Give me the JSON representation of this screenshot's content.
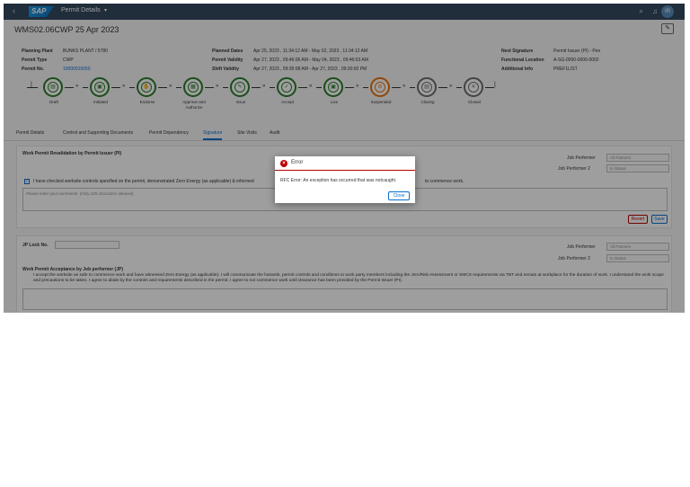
{
  "shell": {
    "back_icon": "‹",
    "logo_text": "SAP",
    "title": "Permit Details",
    "chevron": "▾",
    "search_icon": "⌕",
    "notification_icon": "♫",
    "avatar_initials": "IR"
  },
  "header": {
    "object_title": "WMS02.06CWP 25 Apr 2023",
    "edit_icon": "✎",
    "left": [
      {
        "label": "Planning Plant",
        "value": "BUNKS PLANT / 5780"
      },
      {
        "label": "Permit Type",
        "value": "CWP"
      },
      {
        "label": "Permit No.",
        "value": "10000010050"
      }
    ],
    "middle": [
      {
        "label": "Planned Dates",
        "value": "Apr 25, 2023 , 11:34:12 AM - May 02, 2023 , 11:34:12 AM"
      },
      {
        "label": "Permit Validity",
        "value": "Apr 27, 2023 , 09:46:06 AM - May 04, 2023 , 09:46:03 AM"
      },
      {
        "label": "Shift Validity",
        "value": "Apr 27, 2023 , 09:35:08 AM - Apr 27, 2023 , 09:30:00 PM"
      }
    ],
    "right": [
      {
        "label": "Next Signature",
        "value": "Permit Issuer (PI) - Pen"
      },
      {
        "label": "Functional Location",
        "value": "A-SG-0000-0000-0002"
      },
      {
        "label": "Additional Info",
        "value": "PREF1LIST"
      }
    ]
  },
  "steps": [
    {
      "label": "Draft",
      "icon": "▤",
      "state": "done"
    },
    {
      "label": "Initiated",
      "icon": "▣",
      "state": "done"
    },
    {
      "label": "Endorse",
      "icon": "✋",
      "state": "done"
    },
    {
      "label": "Approve and Authorize",
      "icon": "▦",
      "state": "done"
    },
    {
      "label": "Issue",
      "icon": "✎",
      "state": "done"
    },
    {
      "label": "Accept",
      "icon": "✓",
      "state": "done"
    },
    {
      "label": "Live",
      "icon": "▣",
      "state": "done"
    },
    {
      "label": "Suspended",
      "icon": "⊘",
      "state": "current"
    },
    {
      "label": "Closing",
      "icon": "▤",
      "state": "pending"
    },
    {
      "label": "Closed",
      "icon": "✕",
      "state": "pending"
    }
  ],
  "tabs": [
    "Permit Details",
    "Control and Supporting Documents",
    "Permit Dependency",
    "Signature",
    "Site Visits",
    "Audit"
  ],
  "active_tab": "Signature",
  "revalidation": {
    "title": "Work Permit Revalidation by Permit Issuer (PI)",
    "job_performer_label": "Job Performer",
    "job_performer_placeholder": "All Partners",
    "job_performer2_label": "Job Performer 2",
    "job_performer2_placeholder": "In Status",
    "checkbox_text": "I have checked worksite controls specified on the permit, demonstrated Zero Energy (as applicable) & informed",
    "checkbox_text_tail": "to commence work.",
    "comment_placeholder": "Please enter your comments. (Only 225 characters allowed)",
    "reject_label": "Revert",
    "save_label": "Save"
  },
  "acceptance": {
    "jp_lock_label": "JP Lock No.",
    "job_performer_label": "Job Performer",
    "job_performer_placeholder": "All Partners",
    "job_performer2_label": "Job Performer 2",
    "job_performer2_placeholder": "In Status",
    "title": "Work Permit Acceptance by Job performer (JP)",
    "text": "I accept the worksite as safe to commence work and have witnessed Zero Energy (as applicable). I will communicate the hazards, permit controls and conditions to work party members including the JSA/Risk Assessment or SMCS requirements via TBT and remain at workplace for the duration of work. I understand the work scope and precautions to be taken. I agree to abide by the controls and requirements described in the permit. I agree to not commence work until clearance has been provided by the Permit Issuer (PI)."
  },
  "dialog": {
    "title": "Error",
    "icon": "×",
    "message": "RFC Error: An exception has occurred that was notcaught.",
    "close_label": "Close"
  }
}
